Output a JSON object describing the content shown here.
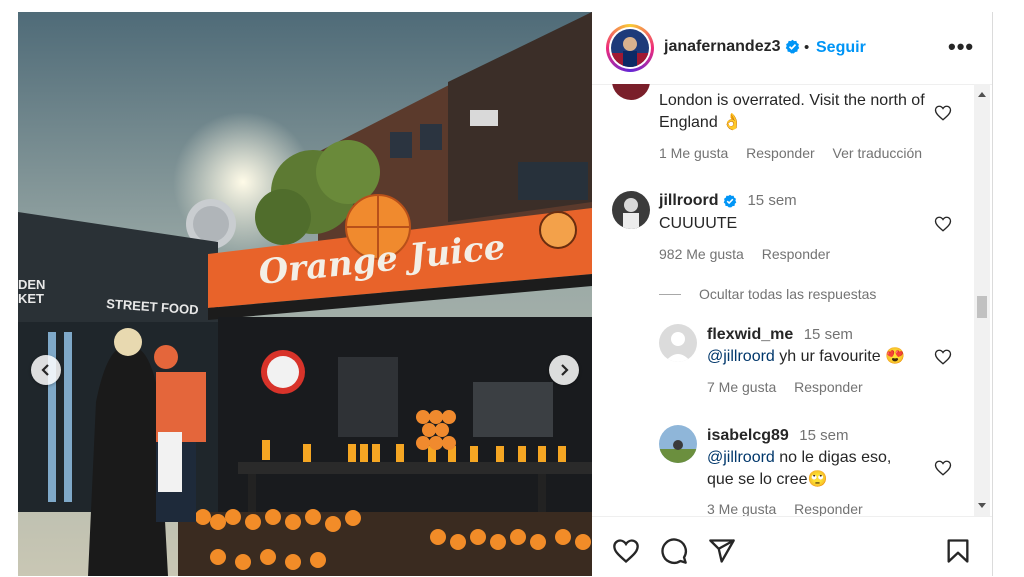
{
  "post": {
    "username": "janafernandez3",
    "dot": "•",
    "follow_label": "Seguir",
    "more_label": "•••",
    "photo_text": {
      "shop_sign": "Orange Juice",
      "wall_left": "DEN\nKET",
      "wall_street_food": "STREET FOOD"
    }
  },
  "comments": [
    {
      "text": "London is overrated. Visit the north of England 👌",
      "likes": "1 Me gusta",
      "reply": "Responder",
      "translate": "Ver traducción"
    },
    {
      "username": "jillroord",
      "time": "15 sem",
      "text": "CUUUUTE",
      "likes": "982 Me gusta",
      "reply": "Responder"
    }
  ],
  "hide_replies": "Ocultar todas las respuestas",
  "replies": [
    {
      "username": "flexwid_me",
      "time": "15 sem",
      "mention": "@jillroord",
      "text": " yh ur favourite 😍",
      "likes": "7 Me gusta",
      "reply": "Responder"
    },
    {
      "username": "isabelcg89",
      "time": "15 sem",
      "mention": "@jillroord",
      "text": " no le digas eso,",
      "text2": "que se lo cree🙄",
      "likes": "3 Me gusta",
      "reply": "Responder"
    }
  ],
  "colors": {
    "accent_blue": "#0095f6",
    "mention_blue": "#00376b",
    "muted": "#737373",
    "orange": "#e8632a"
  },
  "icons": [
    "chevron-left-icon",
    "chevron-right-icon",
    "verified-icon",
    "heart-icon",
    "comment-icon",
    "share-icon",
    "bookmark-icon"
  ]
}
